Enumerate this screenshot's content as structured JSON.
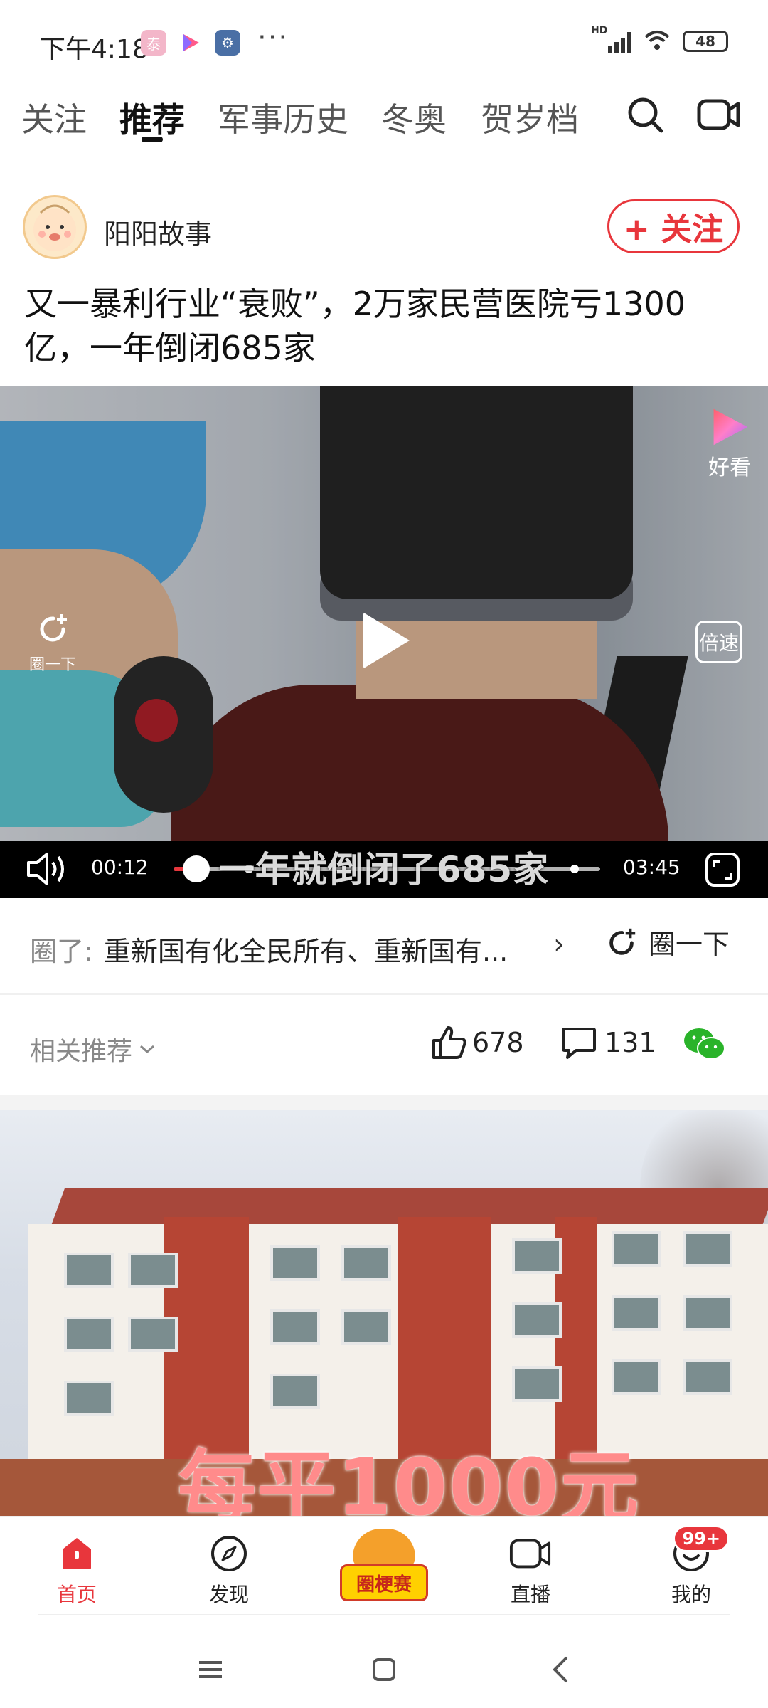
{
  "status_bar": {
    "time": "下午4:18",
    "app_icons": [
      "taiqi-app-icon",
      "video-app-icon",
      "settings-app-icon"
    ],
    "more": "···",
    "signal": "HD",
    "battery": "48"
  },
  "tabs": [
    {
      "label": "关注",
      "active": false
    },
    {
      "label": "推荐",
      "active": true
    },
    {
      "label": "军事历史",
      "active": false
    },
    {
      "label": "冬奥",
      "active": false
    },
    {
      "label": "贺岁档",
      "active": false
    }
  ],
  "post": {
    "author": "阳阳故事",
    "follow_label": "+ 关注",
    "title": "又一暴利行业“衰败”，2万家民营医院亏1300亿，一年倒闭685家"
  },
  "video": {
    "brand": "好看",
    "loop_label": "圈一下",
    "speed_label": "倍速",
    "time_current": "00:12",
    "time_total": "03:45",
    "progress": 0.053,
    "subtitle": "一年就倒闭了685家"
  },
  "circle": {
    "prefix": "圈了:",
    "text": "重新国有化全民所有、重新国有...",
    "chevron": "›",
    "button_label": "圈一下"
  },
  "actions": {
    "related_label": "相关推荐",
    "likes": "678",
    "comments": "131"
  },
  "next_card": {
    "overlay_text": "每平1000元"
  },
  "bottom_nav": {
    "items": [
      {
        "label": "首页",
        "active": true
      },
      {
        "label": "发现",
        "active": false
      },
      {
        "label": "圈梗赛",
        "active": false
      },
      {
        "label": "直播",
        "active": false
      },
      {
        "label": "我的",
        "active": false
      }
    ],
    "badge": "99+"
  },
  "colors": {
    "accent": "#e8363c",
    "text": "#222222",
    "muted": "#888888"
  }
}
